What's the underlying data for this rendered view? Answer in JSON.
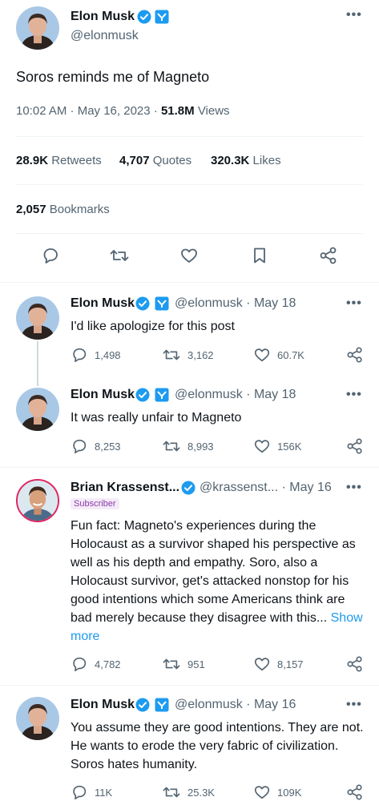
{
  "main_tweet": {
    "author_name": "Elon Musk",
    "author_handle": "@elonmusk",
    "text": "Soros reminds me of Magneto",
    "time": "10:02 AM · May 16, 2023 ·",
    "views_count": "51.8M",
    "views_label": "Views",
    "retweets_count": "28.9K",
    "retweets_label": "Retweets",
    "quotes_count": "4,707",
    "quotes_label": "Quotes",
    "likes_count": "320.3K",
    "likes_label": "Likes",
    "bookmarks_count": "2,057",
    "bookmarks_label": "Bookmarks"
  },
  "replies": [
    {
      "author_name": "Elon Musk",
      "author_handle": "@elonmusk",
      "date": "· May 18",
      "text": "I'd like apologize for this post",
      "replies": "1,498",
      "retweets": "3,162",
      "likes": "60.7K"
    },
    {
      "author_name": "Elon Musk",
      "author_handle": "@elonmusk",
      "date": "· May 18",
      "text": "It was really unfair to Magneto",
      "replies": "8,253",
      "retweets": "8,993",
      "likes": "156K"
    },
    {
      "author_name": "Brian Krassenst...",
      "author_handle": "@krassenst...",
      "date": "· May 16",
      "badge": "Subscriber",
      "text_lines": [
        "Fun fact:  Magneto's experiences during the",
        "Holocaust as a survivor shaped his perspective as",
        "well as his depth and empathy.  Soro, also a",
        "Holocaust survivor, get's attacked nonstop for his",
        "good intentions which some Americans think are",
        "bad merely because they disagree with this..."
      ],
      "show_more_1": "Show",
      "show_more_2": "more",
      "replies": "4,782",
      "retweets": "951",
      "likes": "8,157"
    },
    {
      "author_name": "Elon Musk",
      "author_handle": "@elonmusk",
      "date": "· May 16",
      "text_lines": [
        "You assume they are good intentions. They are not.",
        "He wants to erode the very fabric of civilization.",
        "Soros hates humanity."
      ],
      "replies": "11K",
      "retweets": "25.3K",
      "likes": "109K"
    }
  ],
  "colors": {
    "verified_blue": "#1d9bf0",
    "text": "#0f1419",
    "muted": "#536471",
    "divider": "#eff3f4"
  }
}
